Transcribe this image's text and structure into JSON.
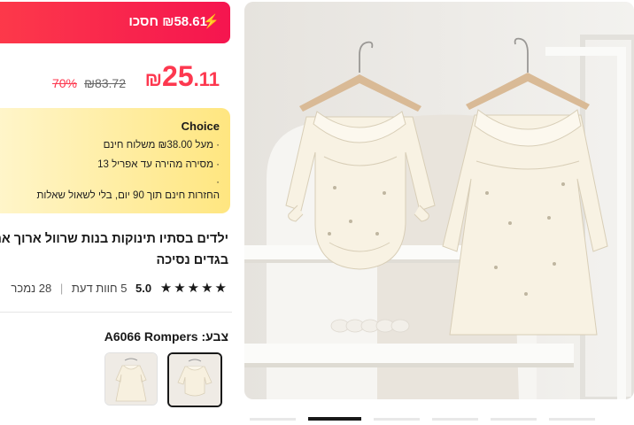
{
  "save_bar": {
    "text": "₪58.61 חסכו",
    "icon": "lightning-icon",
    "color": "#fd384f"
  },
  "price": {
    "currency": "₪",
    "integer": "25",
    "decimal": ".11",
    "original": "₪83.72",
    "discount": "70%"
  },
  "choice": {
    "title": "Choice",
    "line1": "· מעל ₪38.00 משלוח חינם",
    "line2": "· מסירה מהירה עד אפריל 13",
    "line3": "·",
    "line4": "החזרות חינם תוך 90 יום, בלי לשאול שאלות"
  },
  "product": {
    "title_line1": "ילדים בסתיו תינוקות בנות שרוול ארוך אחיות",
    "title_line2": "בגדים נסיכה"
  },
  "rating": {
    "stars": "★★★★★",
    "score": "5.0",
    "reviews": "5 חוות דעת",
    "separator": "|",
    "sold": "28 נמכר"
  },
  "variant": {
    "label": "צבע: A6066 Rompers"
  },
  "images": {
    "main_alt": "cream baby romper and dress on hangers",
    "thumb1": "Rompers",
    "thumb2": "Dress"
  }
}
